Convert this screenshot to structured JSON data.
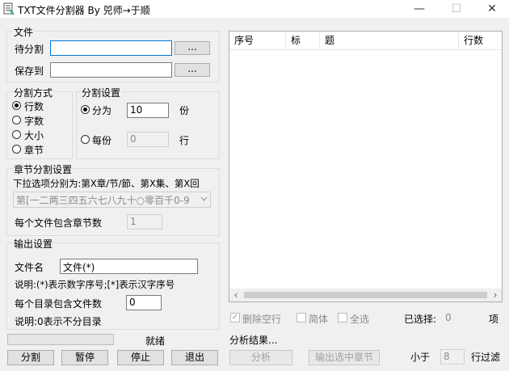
{
  "window": {
    "title": "TXT文件分割器  By 兕师→于顺",
    "minimize": "—",
    "maximize": "☐",
    "close": "✕"
  },
  "file_group": {
    "label": "文件",
    "source_label": "待分割",
    "source_value": "",
    "browse1": "...",
    "save_label": "保存到",
    "save_value": "",
    "browse2": "..."
  },
  "split_mode": {
    "label": "分割方式",
    "options": [
      "行数",
      "字数",
      "大小",
      "章节"
    ],
    "selected": "行数"
  },
  "split_settings": {
    "label": "分割设置",
    "part_label": "分为",
    "part_value": "10",
    "part_unit": "份",
    "each_label": "每份",
    "each_value": "0",
    "each_unit": "行",
    "selected": "分为"
  },
  "chapter_settings": {
    "label": "章节分割设置",
    "hint": "下拉选项分别为:第X章/节/節、第X集、第X回",
    "pattern_value": "第[一二两三四五六七八九十○零百千0-9",
    "per_file_label": "每个文件包含章节数",
    "per_file_value": "1"
  },
  "output_settings": {
    "label": "输出设置",
    "filename_label": "文件名",
    "filename_value": "文件(*)",
    "note1": "说明:(*)表示数字序号;[*]表示汉字序号",
    "per_dir_label": "每个目录包含文件数",
    "per_dir_value": "0",
    "note2": "说明:0表示不分目录"
  },
  "status": {
    "text": "就绪",
    "progress": 0
  },
  "actions": {
    "split": "分割",
    "pause": "暂停",
    "stop": "停止",
    "exit": "退出"
  },
  "list": {
    "columns": [
      "序号",
      "标",
      "题",
      "行数"
    ],
    "rows": [],
    "scroll_left": "‹",
    "scroll_right": "›"
  },
  "options": {
    "remove_blank": "删除空行",
    "remove_blank_checked": true,
    "simplified": "简体",
    "simplified_checked": false,
    "select_all": "全选",
    "select_all_checked": false,
    "selected_label": "已选择:",
    "selected_count": "0",
    "selected_unit": "项"
  },
  "analysis": {
    "result_label": "分析结果...",
    "analyze_button": "分析",
    "export_button": "输出选中章节",
    "less_than_label": "小于",
    "less_than_value": "8",
    "filter_label": "行过滤"
  }
}
